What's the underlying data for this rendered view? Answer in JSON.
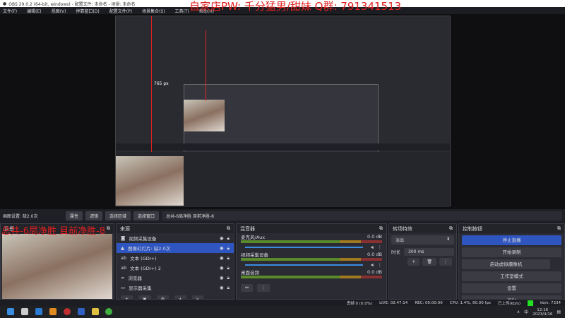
{
  "window": {
    "title": "OBS 29.0.2 (64-bit, windows) - 配置文件: 未命名 - 场景: 未命名"
  },
  "menu": [
    "文件(F)",
    "编辑(E)",
    "视图(V)",
    "停靠窗口(D)",
    "配置文件(P)",
    "场景集合(S)",
    "工具(T)",
    "帮助(H)"
  ],
  "watermark": "自家店PW: 千分猛男/甜妹 Q群: 791341513",
  "overlay": "总共-6局净胜 目前净胜-8",
  "preview": {
    "measure_label": "765 px",
    "colors": {
      "guide": "#e02020"
    }
  },
  "toolbar": {
    "source_label": "画图设置: 缺2.0次",
    "properties": "属性",
    "filters": "滤镜",
    "select_region": "选择区域",
    "select_window": "选择窗口",
    "text_field": "总共-6局净胜 目前净胜-8"
  },
  "scenes": {
    "title": "场景"
  },
  "sources": {
    "title": "来源",
    "items": [
      {
        "icon": "camera-icon",
        "label": "视频采集设备"
      },
      {
        "icon": "image-icon",
        "label": "图像幻灯片: 缺2.0次"
      },
      {
        "icon": "text-icon",
        "label": "文本 (GDI+)"
      },
      {
        "icon": "text-icon",
        "label": "文本 (GDI+) 2"
      },
      {
        "icon": "link-icon",
        "label": "浏览器"
      },
      {
        "icon": "monitor-icon",
        "label": "显示器采集"
      }
    ]
  },
  "mixer": {
    "title": "混音器",
    "channels": [
      {
        "name": "麦克风/Aux",
        "db": "0.0 dB"
      },
      {
        "name": "视频采集设备",
        "db": "0.0 dB"
      },
      {
        "name": "桌面音频",
        "db": "0.0 dB"
      }
    ]
  },
  "transitions": {
    "title": "转场特效",
    "type": "淡出",
    "duration_label": "时长",
    "duration": "300 ms"
  },
  "controls": {
    "title": "控制按钮",
    "buttons": [
      "停止直播",
      "开始录制",
      "启动虚拟摄像机",
      "工作室模式",
      "设置",
      "退出"
    ]
  },
  "status": {
    "dropped": "丢帧 0 (0.0%)",
    "live": "LIVE: 02:47:14",
    "rec": "REC: 00:00:00",
    "cpu": "CPU: 1.4%, 60.00 fps",
    "bitrate_label": "已上传(kb/s)",
    "kbps": "kb/s: 7334",
    "indicator_color": "#22e022"
  },
  "taskbar": {
    "time": "12:16",
    "date": "2023/4/16",
    "ime": "中"
  }
}
